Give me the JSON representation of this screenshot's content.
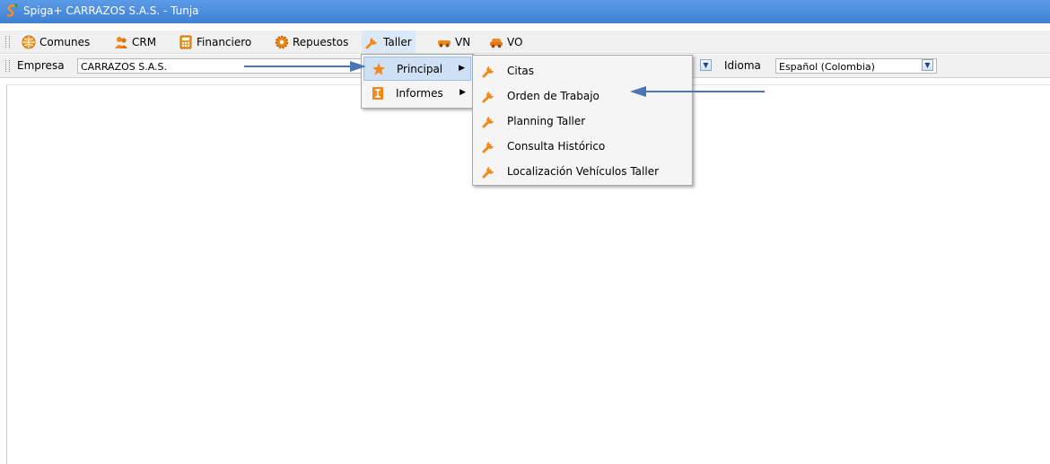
{
  "window": {
    "title": "Spiga+ CARRAZOS S.A.S. - Tunja"
  },
  "menubar": {
    "items": [
      {
        "label": "Comunes",
        "icon": "globe-icon"
      },
      {
        "label": "CRM",
        "icon": "users-icon"
      },
      {
        "label": "Financiero",
        "icon": "calculator-icon"
      },
      {
        "label": "Repuestos",
        "icon": "gear-icon"
      },
      {
        "label": "Taller",
        "icon": "wrench-icon"
      },
      {
        "label": "VN",
        "icon": "car-new-icon"
      },
      {
        "label": "VO",
        "icon": "car-used-icon"
      }
    ]
  },
  "toolbar": {
    "empresa_label": "Empresa",
    "empresa_value": "CARRAZOS S.A.S.",
    "idioma_label": "Idioma",
    "idioma_value": "Español (Colombia)"
  },
  "taller_menu": {
    "items": [
      {
        "label": "Principal",
        "icon": "star-icon",
        "has_submenu": true
      },
      {
        "label": "Informes",
        "icon": "report-icon",
        "has_submenu": true
      }
    ]
  },
  "principal_submenu": {
    "items": [
      {
        "label": "Citas",
        "icon": "wrench-icon"
      },
      {
        "label": "Orden de Trabajo",
        "icon": "wrench-icon"
      },
      {
        "label": "Planning Taller",
        "icon": "wrench-icon"
      },
      {
        "label": "Consulta Histórico",
        "icon": "wrench-icon"
      },
      {
        "label": "Localización Vehículos Taller",
        "icon": "wrench-icon"
      }
    ]
  },
  "colors": {
    "titlebar": "#4a8ddf",
    "highlight": "#cfe0f5",
    "annotation_arrow": "#4a76b8",
    "wrench": "#f08a1c"
  }
}
